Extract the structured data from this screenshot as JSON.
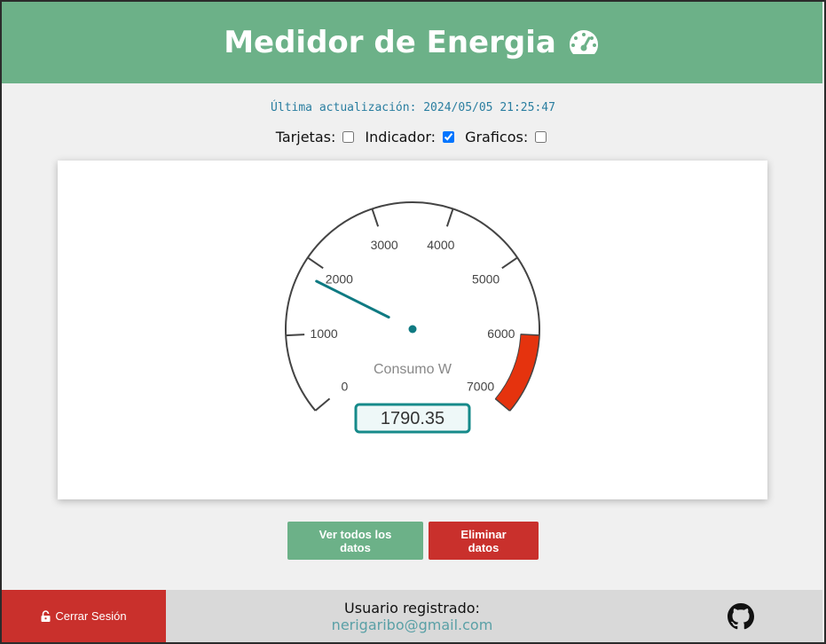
{
  "header": {
    "title": "Medidor de Energia",
    "icon": "gauge-icon"
  },
  "last_update": "Última actualización: 2024/05/05 21:25:47",
  "toggles": [
    {
      "label": "Tarjetas:",
      "checked": false
    },
    {
      "label": "Indicador:",
      "checked": true
    },
    {
      "label": "Graficos:",
      "checked": false
    }
  ],
  "gauge": {
    "min": 0,
    "max": 7000,
    "value": 1790.35,
    "value_text": "1790.35",
    "label": "Consumo W",
    "tick_labels": [
      "0",
      "1000",
      "2000",
      "3000",
      "4000",
      "5000",
      "6000",
      "7000"
    ],
    "red_zone_start": 6000,
    "colors": {
      "needle": "#0f7a82",
      "red_zone": "#e5330e",
      "value_border": "#168a8a"
    }
  },
  "buttons": {
    "view_all": "Ver todos los datos",
    "delete": "Eliminar datos"
  },
  "footer": {
    "logout": "Cerrar Sesión",
    "user_label": "Usuario registrado:",
    "user_email": "nerigaribo@gmail.com"
  },
  "colors": {
    "primary_green": "#6cb188",
    "danger_red": "#c9302c"
  }
}
